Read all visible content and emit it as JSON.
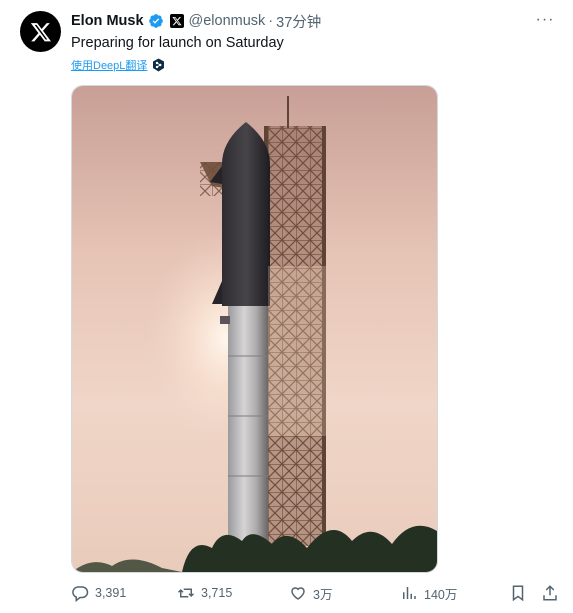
{
  "author": {
    "name": "Elon Musk",
    "handle": "@elonmusk",
    "separator": "·",
    "time": "37分钟",
    "avatar_icon": "x-logo-icon",
    "verified_color": "#1d9bf0"
  },
  "tweet": {
    "text": "Preparing for launch on Saturday",
    "translate_label": "使用DeepL翻译",
    "media_alt": "Starship on launch tower at sunset"
  },
  "more_label": "···",
  "actions": {
    "replies": "3,391",
    "retweets": "3,715",
    "likes": "3万",
    "views": "140万"
  },
  "colors": {
    "accent": "#1d9bf0",
    "text": "#0f1419",
    "muted": "#536471"
  }
}
